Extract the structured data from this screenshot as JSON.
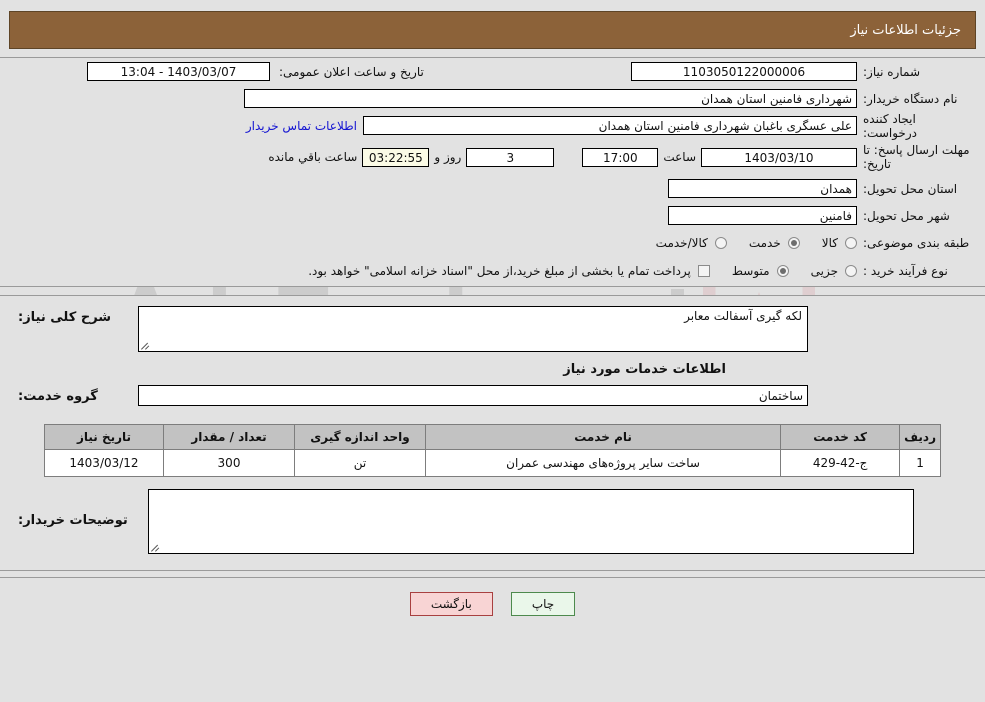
{
  "header": {
    "title": "جزئیات اطلاعات نیاز",
    "bg_color": "#8c6239"
  },
  "watermark": {
    "text": "AriaTender.net",
    "logo": "shield-logo"
  },
  "form": {
    "need_number": {
      "label": "شماره نیاز:",
      "value": "1103050122000006"
    },
    "announce": {
      "label": "تاریخ و ساعت اعلان عمومی:",
      "value": "1403/03/07 - 13:04"
    },
    "buyer_org": {
      "label": "نام دستگاه خریدار:",
      "value": "شهرداری فامنین استان همدان"
    },
    "creator": {
      "label": "ایجاد کننده درخواست:",
      "value": "علی عسگری باغبان شهرداری فامنین استان همدان",
      "contact_link": "اطلاعات تماس خریدار"
    },
    "deadline": {
      "label": "مهلت ارسال پاسخ: تا تاریخ:",
      "date": "1403/03/10",
      "time_label": "ساعت",
      "time": "17:00",
      "days": "3",
      "days_suffix": "روز و",
      "countdown": "03:22:55",
      "countdown_suffix": "ساعت باقي مانده"
    },
    "province": {
      "label": "استان محل تحویل:",
      "value": "همدان"
    },
    "city": {
      "label": "شهر محل تحویل:",
      "value": "فامنین"
    },
    "category": {
      "label": "طبقه بندی موضوعی:",
      "options": [
        {
          "text": "کالا",
          "selected": false
        },
        {
          "text": "خدمت",
          "selected": true
        },
        {
          "text": "کالا/خدمت",
          "selected": false
        }
      ]
    },
    "process": {
      "label": "نوع فرآیند خرید :",
      "options": [
        {
          "text": "جزیی",
          "selected": false
        },
        {
          "text": "متوسط",
          "selected": true
        }
      ],
      "checkbox_checked": false,
      "note": "پرداخت تمام یا بخشی از مبلغ خرید،از محل \"اسناد خزانه اسلامی\" خواهد بود."
    }
  },
  "description": {
    "label": "شرح کلی نیاز:",
    "value": "لکه گیری آسفالت معابر",
    "section_title": "اطلاعات خدمات مورد نیاز",
    "service_group_label": "گروه خدمت:",
    "service_group_value": "ساختمان"
  },
  "table": {
    "columns": [
      "ردیف",
      "کد خدمت",
      "نام خدمت",
      "واحد اندازه گیری",
      "تعداد / مقدار",
      "تاریخ نیاز"
    ],
    "rows": [
      {
        "row": "1",
        "code": "ج-42-429",
        "name": "ساخت سایر پروژه‌های مهندسی عمران",
        "unit": "تن",
        "quantity": "300",
        "date": "1403/03/12"
      }
    ]
  },
  "buyer_notes": {
    "label": "توضیحات خریدار:",
    "value": ""
  },
  "buttons": {
    "print": "چاپ",
    "back": "بازگشت"
  }
}
